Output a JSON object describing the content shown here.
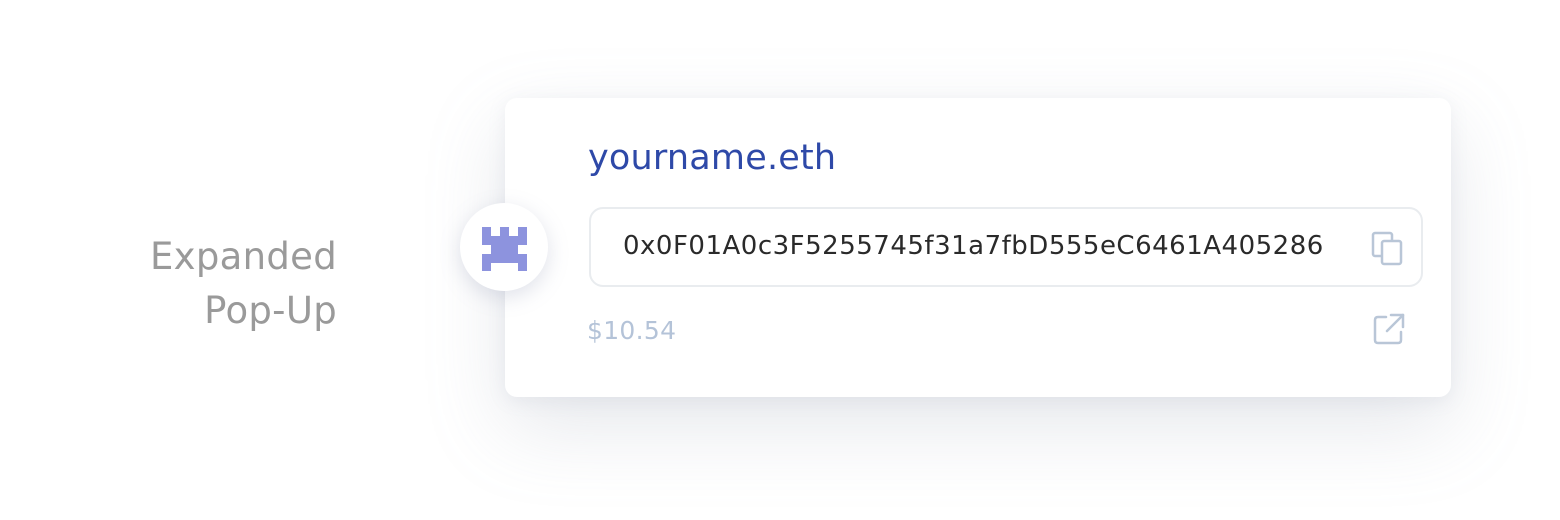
{
  "label": {
    "line1": "Expanded",
    "line2": "Pop-Up"
  },
  "popup": {
    "name": "yourname.eth",
    "address": "0x0F01A0c3F5255745f31a7fbD555eC6461A405286",
    "balance": "$10.54"
  },
  "icons": {
    "avatar": "identicon-avatar",
    "copy": "copy-icon",
    "external": "external-link-icon"
  },
  "colors": {
    "name": "#2e49a8",
    "address": "#2a2a2a",
    "balance": "#b4c3d8",
    "icon": "#b9c6d7",
    "avatar_pattern": "#8d93de",
    "label": "#9a9a9a"
  }
}
